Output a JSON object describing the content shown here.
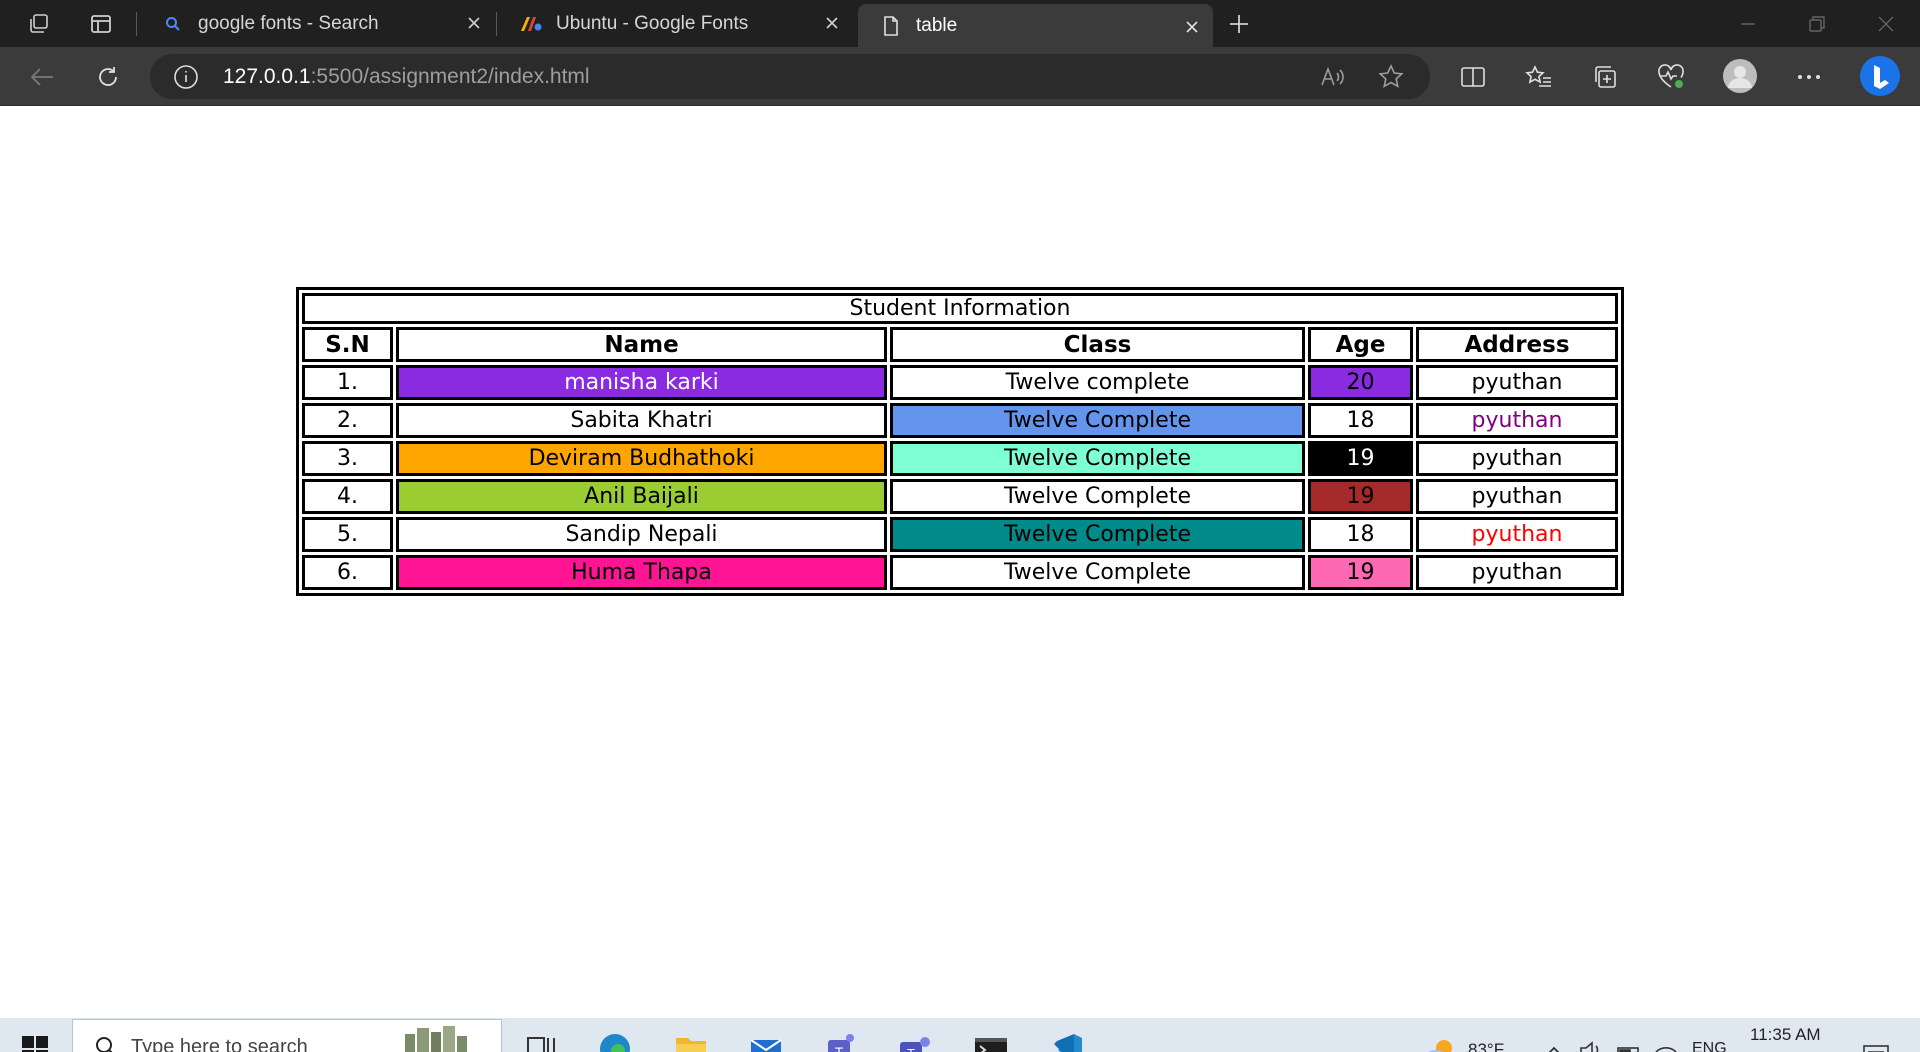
{
  "browser": {
    "tabs": [
      {
        "title": "google fonts - Search",
        "active": false,
        "favicon": "search-icon"
      },
      {
        "title": "Ubuntu - Google Fonts",
        "active": false,
        "favicon": "google-fonts-icon"
      },
      {
        "title": "table",
        "active": true,
        "favicon": "page-icon"
      }
    ],
    "address": {
      "host": "127.0.0.1",
      "rest": ":5500/assignment2/index.html"
    }
  },
  "page": {
    "caption": "Student Information",
    "headers": [
      "S.N",
      "Name",
      "Class",
      "Age",
      "Address"
    ],
    "rows": [
      {
        "sn": "1.",
        "name": "manisha karki",
        "class": "Twelve complete",
        "age": "20",
        "address": "pyuthan"
      },
      {
        "sn": "2.",
        "name": "Sabita Khatri",
        "class": "Twelve Complete",
        "age": "18",
        "address": "pyuthan"
      },
      {
        "sn": "3.",
        "name": "Deviram Budhathoki",
        "class": "Twelve Complete",
        "age": "19",
        "address": "pyuthan"
      },
      {
        "sn": "4.",
        "name": "Anil Baijali",
        "class": "Twelve Complete",
        "age": "19",
        "address": "pyuthan"
      },
      {
        "sn": "5.",
        "name": "Sandip Nepali",
        "class": "Twelve Complete",
        "age": "18",
        "address": "pyuthan"
      },
      {
        "sn": "6.",
        "name": "Huma Thapa",
        "class": "Twelve Complete",
        "age": "19",
        "address": "pyuthan"
      }
    ],
    "cell_colors": {
      "name_bg": [
        "#8a2be2",
        "#ffffff",
        "#ffa500",
        "#9acd32",
        "#ffffff",
        "#ff1493"
      ],
      "name_fg": [
        "#ffffff",
        "#000000",
        "#000000",
        "#000000",
        "#000000",
        "#000000"
      ],
      "class_bg": [
        "#ffffff",
        "#6495ed",
        "#7fffd4",
        "#ffffff",
        "#008b8b",
        "#ffffff"
      ],
      "age_bg": [
        "#8a2be2",
        "#ffffff",
        "#000000",
        "#a52a2a",
        "#ffffff",
        "#ff69b4"
      ],
      "age_fg": [
        "#000000",
        "#000000",
        "#ffffff",
        "#000000",
        "#000000",
        "#000000"
      ],
      "address_fg": [
        "#000000",
        "#800080",
        "#000000",
        "#000000",
        "#ff0000",
        "#000000"
      ]
    }
  },
  "taskbar": {
    "search_placeholder": "Type here to search",
    "weather": "83°F",
    "language": "ENG",
    "time": "11:35 AM"
  }
}
